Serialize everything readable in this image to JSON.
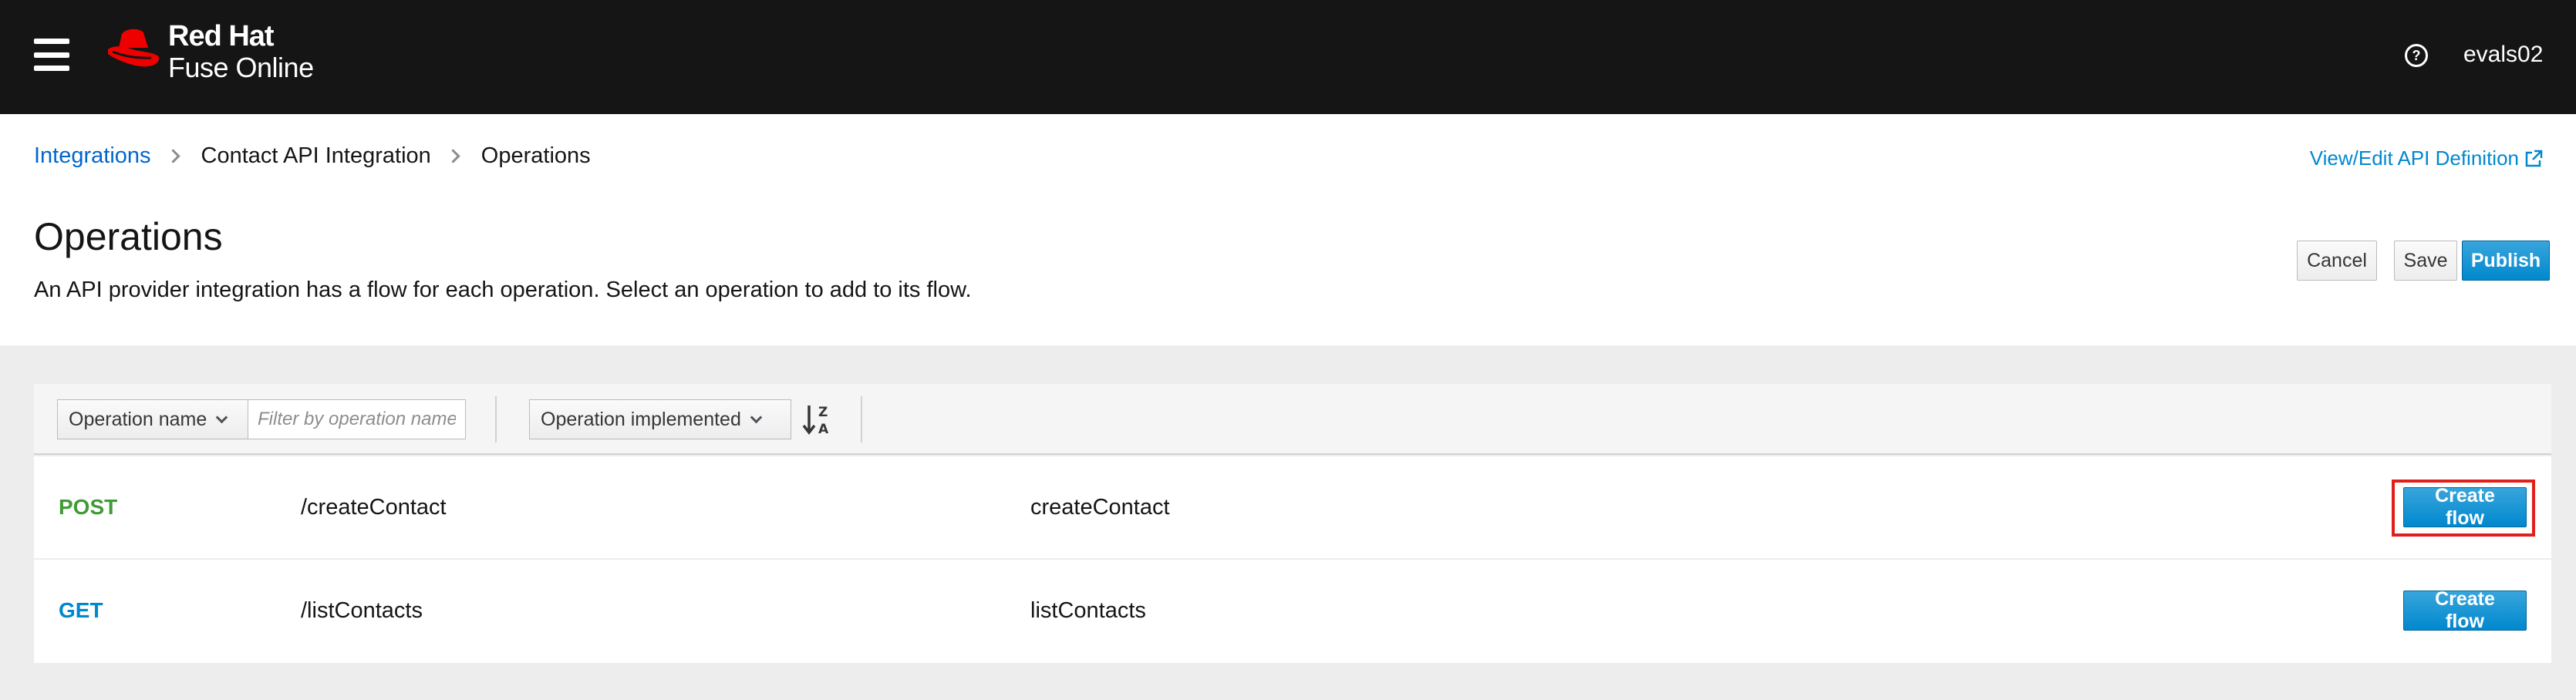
{
  "masthead": {
    "brand_line1": "Red Hat",
    "brand_line2": "Fuse Online",
    "user": "evals02",
    "icons": {
      "menu": "hamburger-menu-icon",
      "logo": "redhat-fedora-logo",
      "help": "help-circle-icon"
    }
  },
  "breadcrumb": [
    {
      "label": "Integrations",
      "link": true
    },
    {
      "label": "Contact API Integration",
      "link": false
    },
    {
      "label": "Operations",
      "link": false
    }
  ],
  "header": {
    "api_definition_link": "View/Edit API Definition",
    "title": "Operations",
    "description": "An API provider integration has a flow for each operation. Select an operation to add to its flow.",
    "cancel_label": "Cancel",
    "save_label": "Save",
    "publish_label": "Publish"
  },
  "toolbar": {
    "filter_field": "Operation name",
    "filter_placeholder": "Filter by operation name",
    "sort_field": "Operation implemented",
    "sort_icon": "sort-alpha-desc-icon"
  },
  "operations": [
    {
      "method": "POST",
      "method_color": "#3f9c35",
      "path": "/createContact",
      "name": "createContact",
      "action": "Create flow",
      "highlighted": true
    },
    {
      "method": "GET",
      "method_color": "#0088ce",
      "path": "/listContacts",
      "name": "listContacts",
      "action": "Create flow",
      "highlighted": false
    }
  ],
  "colors": {
    "masthead_bg": "#151515",
    "link": "#0066cc",
    "primary": "#0088ce",
    "highlight_box": "#e0201b"
  }
}
